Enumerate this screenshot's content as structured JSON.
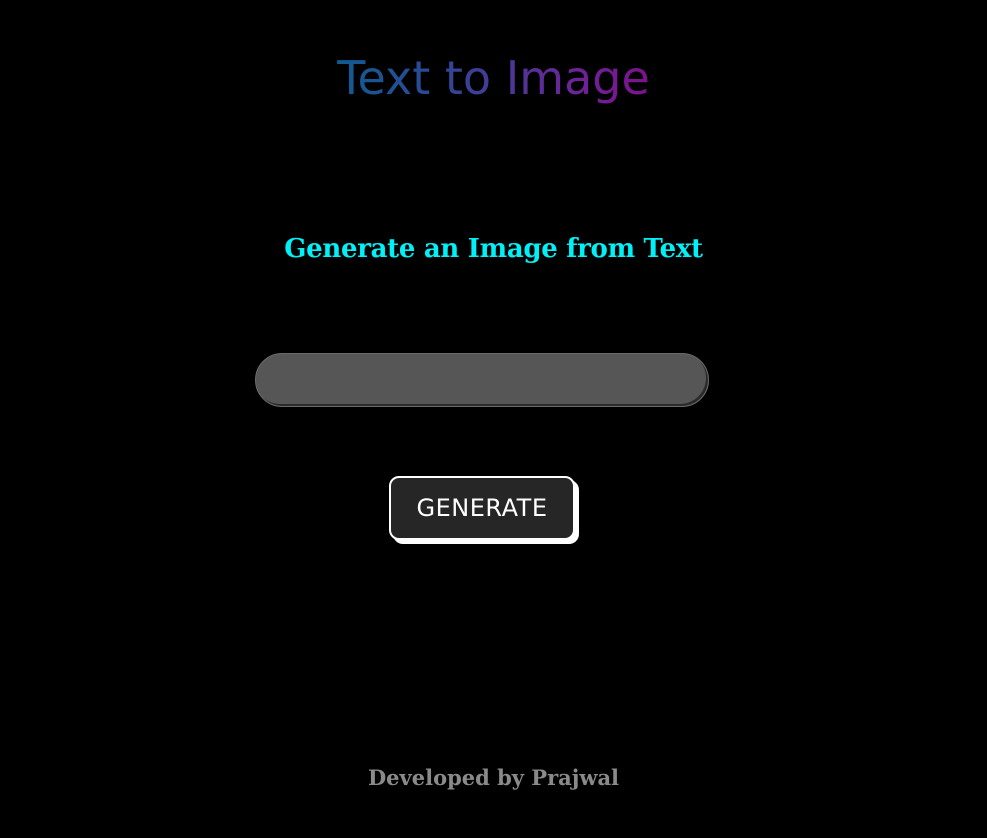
{
  "header": {
    "title": "Text to Image"
  },
  "main": {
    "subtitle": "Generate an Image from Text",
    "prompt_input": {
      "value": "",
      "placeholder": ""
    },
    "generate_label": "GENERATE"
  },
  "footer": {
    "credit": "Developed by Prajwal"
  },
  "colors": {
    "background": "#000000",
    "title_gradient_start": "#0e5c93",
    "title_gradient_end": "#7f1090",
    "subtitle": "#00f0f8",
    "input_background": "#565656",
    "button_background": "#262626",
    "button_border": "#ffffff",
    "footer_text": "#8a8a8a"
  }
}
